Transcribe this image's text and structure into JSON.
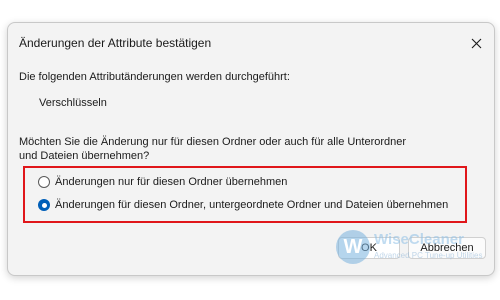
{
  "dialog": {
    "title": "Änderungen der Attribute bestätigen",
    "intro": "Die folgenden Attributänderungen werden durchgeführt:",
    "attribute": "Verschlüsseln",
    "question": "Möchten Sie die Änderung nur für diesen Ordner oder auch für alle Unterordner und Dateien übernehmen?",
    "options": [
      {
        "label": "Änderungen nur für diesen Ordner übernehmen",
        "selected": false
      },
      {
        "label": "Änderungen für diesen Ordner, untergeordnete Ordner und Dateien übernehmen",
        "selected": true
      }
    ],
    "buttons": {
      "ok": "OK",
      "cancel": "Abbrechen"
    }
  },
  "watermark": {
    "logo": "W",
    "name": "WiseCleaner",
    "tagline": "Advanced PC Tune-up Utilities"
  },
  "colors": {
    "highlight_border": "#e0161a",
    "radio_accent": "#005fb8",
    "dialog_bg": "#f3f3f3"
  },
  "icons": {
    "close": "close-icon"
  }
}
